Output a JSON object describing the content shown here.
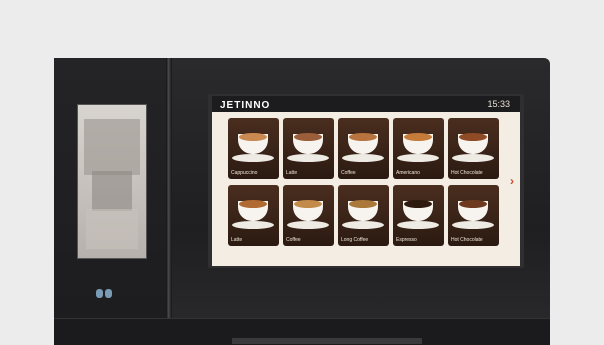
{
  "brand": "JETINNO",
  "clock": "15:33",
  "colors": {
    "tile_bg": "#3a2417",
    "screen_bg": "#f3ede4",
    "accent": "#d04a2a",
    "machine_body": "#222224"
  },
  "tiles": [
    {
      "label": "Cappuccino",
      "crema": "#c98a52"
    },
    {
      "label": "Latte",
      "crema": "#9a5e3a"
    },
    {
      "label": "Coffee",
      "crema": "#b7743e"
    },
    {
      "label": "Americano",
      "crema": "#c57c3a"
    },
    {
      "label": "Hot Chocolate",
      "crema": "#8f4a26"
    },
    {
      "label": "Latte",
      "crema": "#b06a32"
    },
    {
      "label": "Coffee",
      "crema": "#c38a4a"
    },
    {
      "label": "Long Coffee",
      "crema": "#a9783a"
    },
    {
      "label": "Espresso",
      "crema": "#2f1a10"
    },
    {
      "label": "Hot Chocolate",
      "crema": "#6d3a1f"
    }
  ],
  "icons": {
    "next": "chevron-right-icon",
    "sensor": "nfc-icon"
  }
}
